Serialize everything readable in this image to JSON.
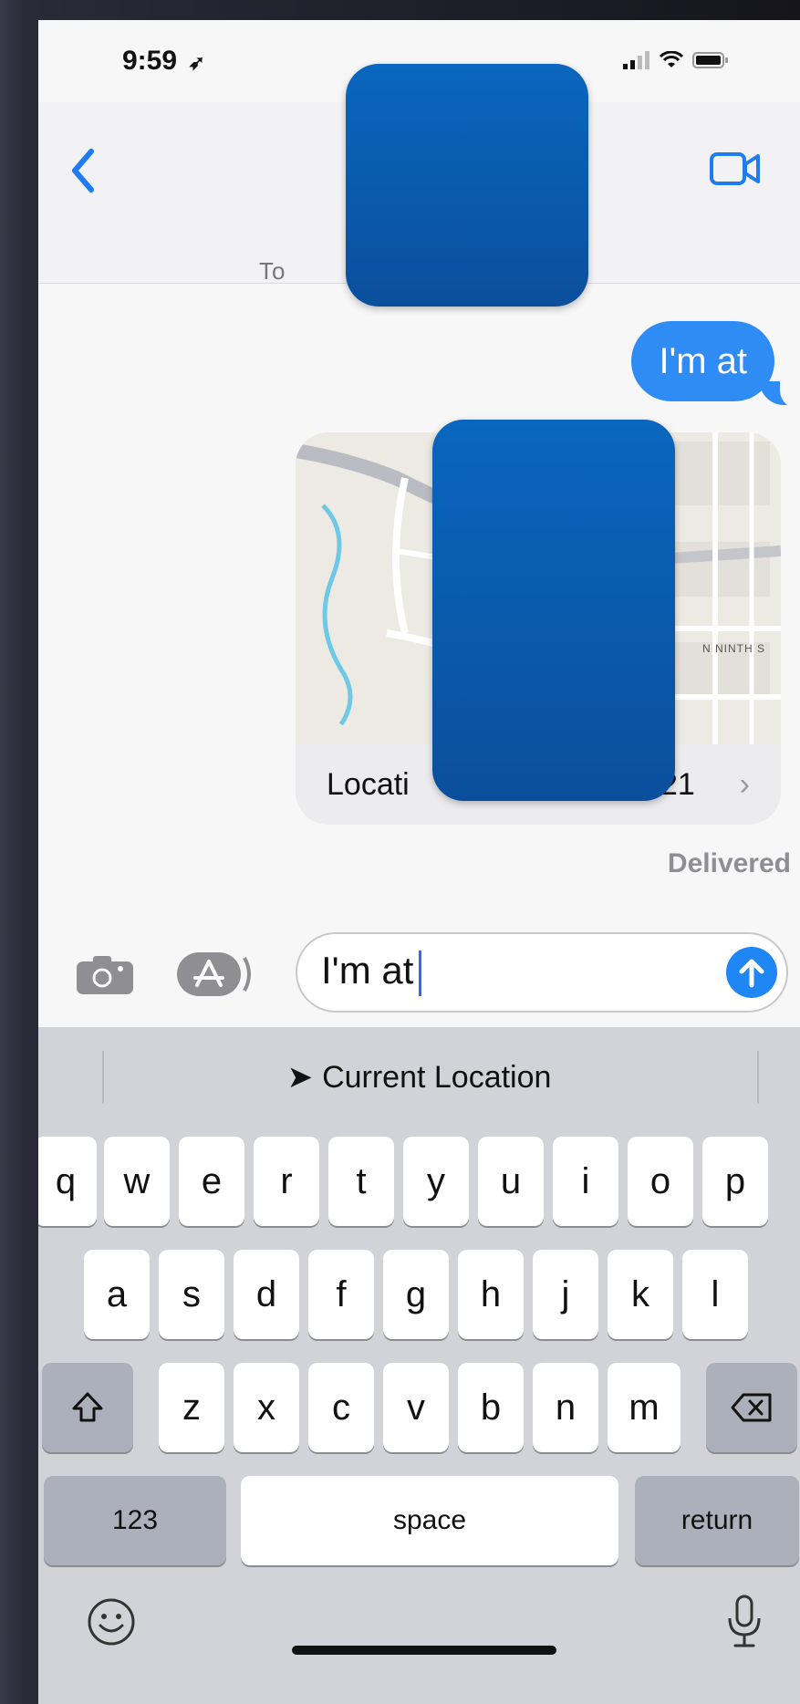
{
  "status_bar": {
    "time": "9:59"
  },
  "thread": {
    "partial_header_text": "To",
    "sent_message": "I'm at",
    "location_card": {
      "label": "Locati",
      "label_suffix": "21",
      "street_label": "N NINTH S"
    },
    "delivered": "Delivered"
  },
  "input": {
    "text": "I'm at"
  },
  "keyboard": {
    "suggestion": "Current Location",
    "row1": [
      "q",
      "w",
      "e",
      "r",
      "t",
      "y",
      "u",
      "i",
      "o",
      "p"
    ],
    "row2": [
      "a",
      "s",
      "d",
      "f",
      "g",
      "h",
      "j",
      "k",
      "l"
    ],
    "row3": [
      "z",
      "x",
      "c",
      "v",
      "b",
      "n",
      "m"
    ],
    "numbers_key": "123",
    "space_key": "space",
    "return_key": "return"
  },
  "colors": {
    "accent": "#2e8cf4",
    "redaction": "#0b58aa"
  }
}
